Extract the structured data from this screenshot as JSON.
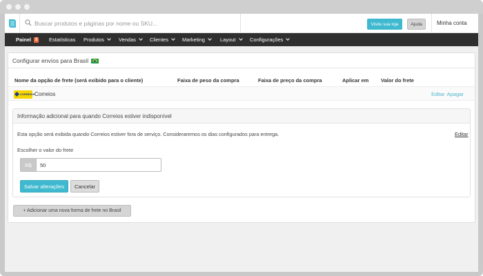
{
  "topbar": {
    "search_placeholder": "Buscar produtos e páginas por nome ou SKU...",
    "visit_store_label": "Visite sua loja",
    "help_label": "Ajuda",
    "account_label": "Minha conta"
  },
  "nav": {
    "items": [
      {
        "label": "Painel",
        "badge": "5"
      },
      {
        "label": "Estatísticas"
      },
      {
        "label": "Produtos"
      },
      {
        "label": "Vendas"
      },
      {
        "label": "Clientes"
      },
      {
        "label": "Marketing"
      },
      {
        "label": "Layout"
      },
      {
        "label": "Configurações"
      }
    ]
  },
  "page": {
    "title": "Configurar envíos para Brasil",
    "table": {
      "headers": [
        "Nome da opção de frete (será exibido para o cliente)",
        "Faixa de peso da compra",
        "Faixa de preço da compra",
        "Aplicar em",
        "Valor do frete"
      ],
      "rows": [
        {
          "name": "Correios",
          "logo_text": "CORREIOS",
          "edit_label": "Editar",
          "delete_label": "Apagar"
        }
      ]
    },
    "info_panel": {
      "title": "Informação adicional para quando Correios estiver indisponível",
      "description": "Esta opção será exibida quando Correios estiver fora de serviço. Consideraremos os dias configurados para entrega.",
      "edit_label": "Editar",
      "field_label": "Escolher o valor do frete",
      "currency": "R$",
      "value": "50",
      "save_label": "Salvar alterações",
      "cancel_label": "Cancelar"
    },
    "add_button_label": "+ Adicionar uma nova forma de frete no Brasil"
  },
  "colors": {
    "accent": "#3fb9cf",
    "nav_bg": "#2f2f2f",
    "badge": "#f0683b"
  }
}
